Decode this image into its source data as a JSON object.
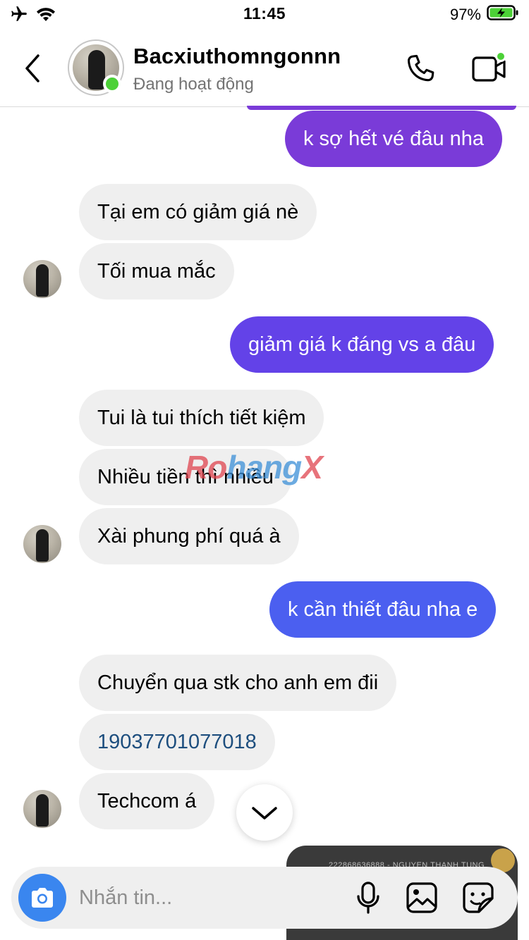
{
  "status_bar": {
    "time": "11:45",
    "battery_percent": "97%",
    "icons": [
      "airplane-icon",
      "wifi-icon",
      "battery-charging-icon"
    ]
  },
  "header": {
    "contact_name": "Bacxiuthomngonnn",
    "contact_status": "Đang hoạt động",
    "icons": [
      "back-icon",
      "phone-icon",
      "video-call-icon"
    ],
    "online": true
  },
  "messages": [
    {
      "side": "outgoing",
      "text": "k sợ hết vé đâu nha",
      "color": "#7a3bd8"
    },
    {
      "side": "incoming",
      "text": "Tại em có giảm giá nè"
    },
    {
      "side": "incoming",
      "text": "Tối mua mắc"
    },
    {
      "side": "outgoing",
      "text": "giảm giá k đáng vs a đâu",
      "color": "#6342e8"
    },
    {
      "side": "incoming",
      "text": "Tui là tui thích tiết kiệm"
    },
    {
      "side": "incoming",
      "text": "Nhiều tiền thì nhiều"
    },
    {
      "side": "incoming",
      "text": "Xài phung phí quá à"
    },
    {
      "side": "outgoing",
      "text": "k cần thiết đâu nha e",
      "color": "#4b5ff0"
    },
    {
      "side": "incoming",
      "text": "Chuyển qua stk cho anh em đii"
    },
    {
      "side": "incoming",
      "text": "19037701077018"
    },
    {
      "side": "incoming",
      "text": "Techcom á"
    }
  ],
  "watermark": {
    "part1": "Ro",
    "part2": "hang",
    "part3": "X"
  },
  "image_preview_text": "222868636888 - NGUYEN THANH TUNG",
  "composer": {
    "placeholder": "Nhắn tin...",
    "icons": [
      "camera-icon",
      "microphone-icon",
      "gallery-icon",
      "sticker-icon"
    ]
  },
  "colors": {
    "incoming_bubble": "#efefef",
    "online_green": "#4cd137",
    "camera_blue": "#3a86ef",
    "link_blue": "#1d4e7e"
  }
}
